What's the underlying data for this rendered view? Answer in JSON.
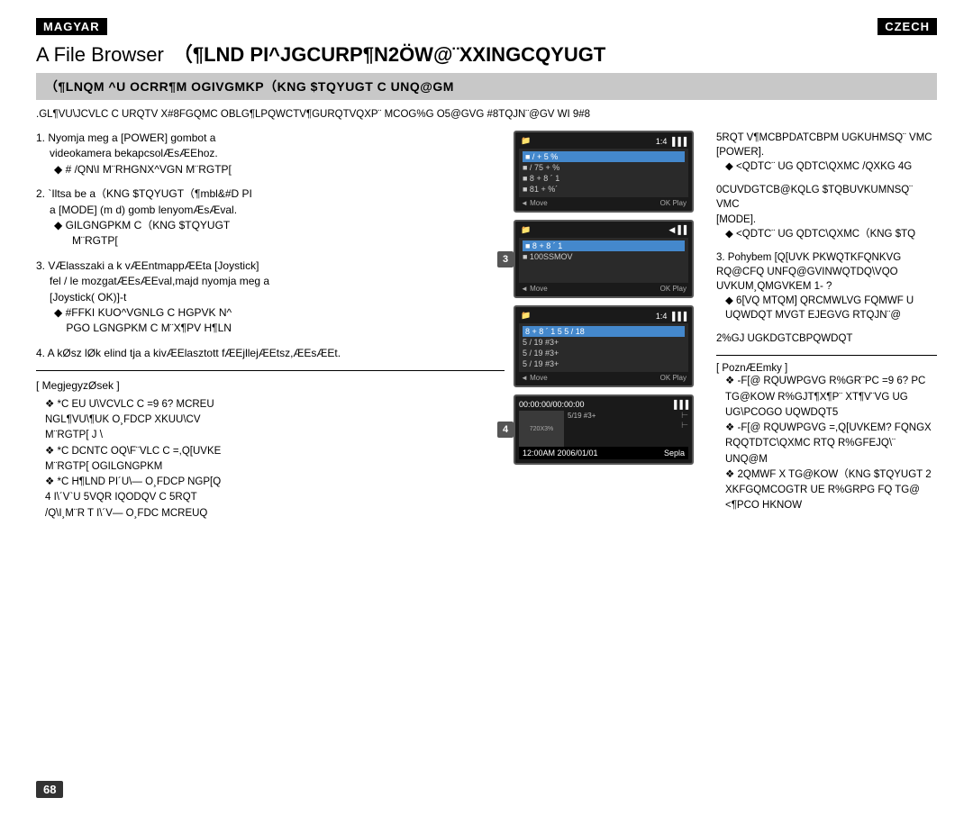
{
  "header": {
    "magyar_label": "MAGYAR",
    "czech_label": "CZECH"
  },
  "title": {
    "file_browser": "A File Browser",
    "subtitle_encoded": "（¶LND PI^JGCURP¶N2ÖW@¨XXINGCQYUGT"
  },
  "subtitle_bar": {
    "text": "（¶LNQM ^U OCRR¶M OGIVGMKP（KNG $TQYUGT C UNQ@GM"
  },
  "intro": {
    "text": ".GL¶VU\\JCVLC C URQTV X#8FGQMC OBLG¶LPQWCTV¶GURQTVQXP¨ MCOG%G O5@GVG #8TQJN¨@GV WI   9#8"
  },
  "steps": [
    {
      "num": "1.",
      "text": "Nyomja meg a [POWER] gombot a\n       videokamera bekapcsolÆsÆEhoz.",
      "bullet": "# /QN\\I M¨RHGNX^VGN M¨RGTP["
    },
    {
      "num": "2.",
      "text": "`Iltsa  be a（KNG $TQYUGT（¶mblD PI\n       a [MODE] (m d)  gomb lenyomÆsÆval.",
      "bullet": "GILGNGPKM C（KNG $TQYUG\n          M¨RGTP["
    },
    {
      "num": "3.",
      "text": "VÆlasszaki a k vÆEntmappÆEta [Joystick]\n       fel / le mozgatÆEsÆEval,majd nyomja meg a\n       [Joystick( OK)]-t",
      "bullet": "#FFKI KUO^VGNLG C HGPVK N^\n          PGO LGNGPKM C M¨X¶PV H¶LN"
    },
    {
      "num": "4.",
      "text": "A kØsz lØk elind tja  a kivÆElasztott fÆEjllejÆEtsz,ÆEsÆEt."
    }
  ],
  "notes": {
    "header": "[ MegjegyzØsek ]",
    "items": [
      "*C EU U\\VCVLC C =9 6? MCREU\nNGL¶VU\\¶UK O¸FDCP XKUU\\CV\nM¨RGTP[ J \\",
      "*C DCNTC OQ\\F¨VLC C =,Q[UVKE\nM¨RGTP[  OGILGNGPKM",
      "*C H¶LND PI´U\\— O¸FDCP NGP[Q\n4 I\\´V`U 5VQR IQODQV C 5RQT\n/Q\\I¸M¨R T I\\´V— O¸FDC MCREUQ"
    ]
  },
  "screens": [
    {
      "id": "screen1",
      "header_left": "1:4",
      "items": [
        "/ + 5 %",
        "/ 75 +%",
        "8 + 8 ´ 1",
        "81 + %´"
      ],
      "selected": 0,
      "footer_left": "Move",
      "footer_right": "OK Play"
    },
    {
      "id": "screen2",
      "step_num": "3",
      "header_left": "",
      "items": [
        "8 + 8 ´ 1",
        "100SSMOV"
      ],
      "selected": 0,
      "footer_left": "Move",
      "footer_right": "OK Play"
    },
    {
      "id": "screen3",
      "header_left": "1:4",
      "items": [
        "8 + 8 ´ 1  5 5 / 18",
        "5 / 19   #3+",
        "5 / 19   #3+",
        "5 / 19   #3+"
      ],
      "selected": 0,
      "footer_left": "Move",
      "footer_right": "OK Play"
    },
    {
      "id": "screen4",
      "step_num": "4",
      "header_left": "00:00:00/00:00:00",
      "thumb_label": "720X3%",
      "items": [
        "5/19  #3+"
      ],
      "timestamp": "12:00AM 2006/01/01",
      "timestamp_right": "Sepla"
    }
  ],
  "right_col": {
    "section1": {
      "intro": "5RQT V¶MCBPDATCBPM UGKUHMSQ¨ VMC\n[POWER].",
      "bullet": "<QDTC¨ UG QDTC\\QXMC /QXKG 4G"
    },
    "section2": {
      "intro": "0CUVDGTCB@KQLG $TQBUVKUMNSQ¨ VMC\n[MODE].",
      "bullet": "<QDTC¨ UG QDTC\\QXMC（KNG $TQ"
    },
    "section3": {
      "num": "3.",
      "text": "Pohybem [Q[UVK PKWQTKFQNKVG\nRQ@CFQ UNFQ@GVINWQTDQ\\VQO\nUVKUM¸QMGVKEM 1- ?",
      "bullet1": "6[VQ MTQM] QRCMWLVG FQMWF U\nUQWDQT MVGT EJEGVG RTQJN¨@"
    },
    "section4": {
      "text": "2%GJ UGKDGTCBPQWDQT"
    },
    "notes": {
      "header": "[ PoznÆEmky ]",
      "items": [
        "-F[@ RQUWPGVG R%GR¨PC =9 6? PC\nTG@KOW R%GJT¶X¶P¨  XT¶V¨VG UG\nUG\\PCOGO UQWDQT5",
        "-F[@ RQUWPGVG =,Q[UVKEM? FQNGX\nRQQDTC\\QXMC RTQ R%GFEJQ\\¨ UNQ@M",
        "2QMWF X TG@KOW（KNG $TQYUGT 2\nXKFGQMCOGTC UG R%GRPG FQ TG@\n<¶PCO HKNOW"
      ]
    }
  },
  "page_number": "68"
}
